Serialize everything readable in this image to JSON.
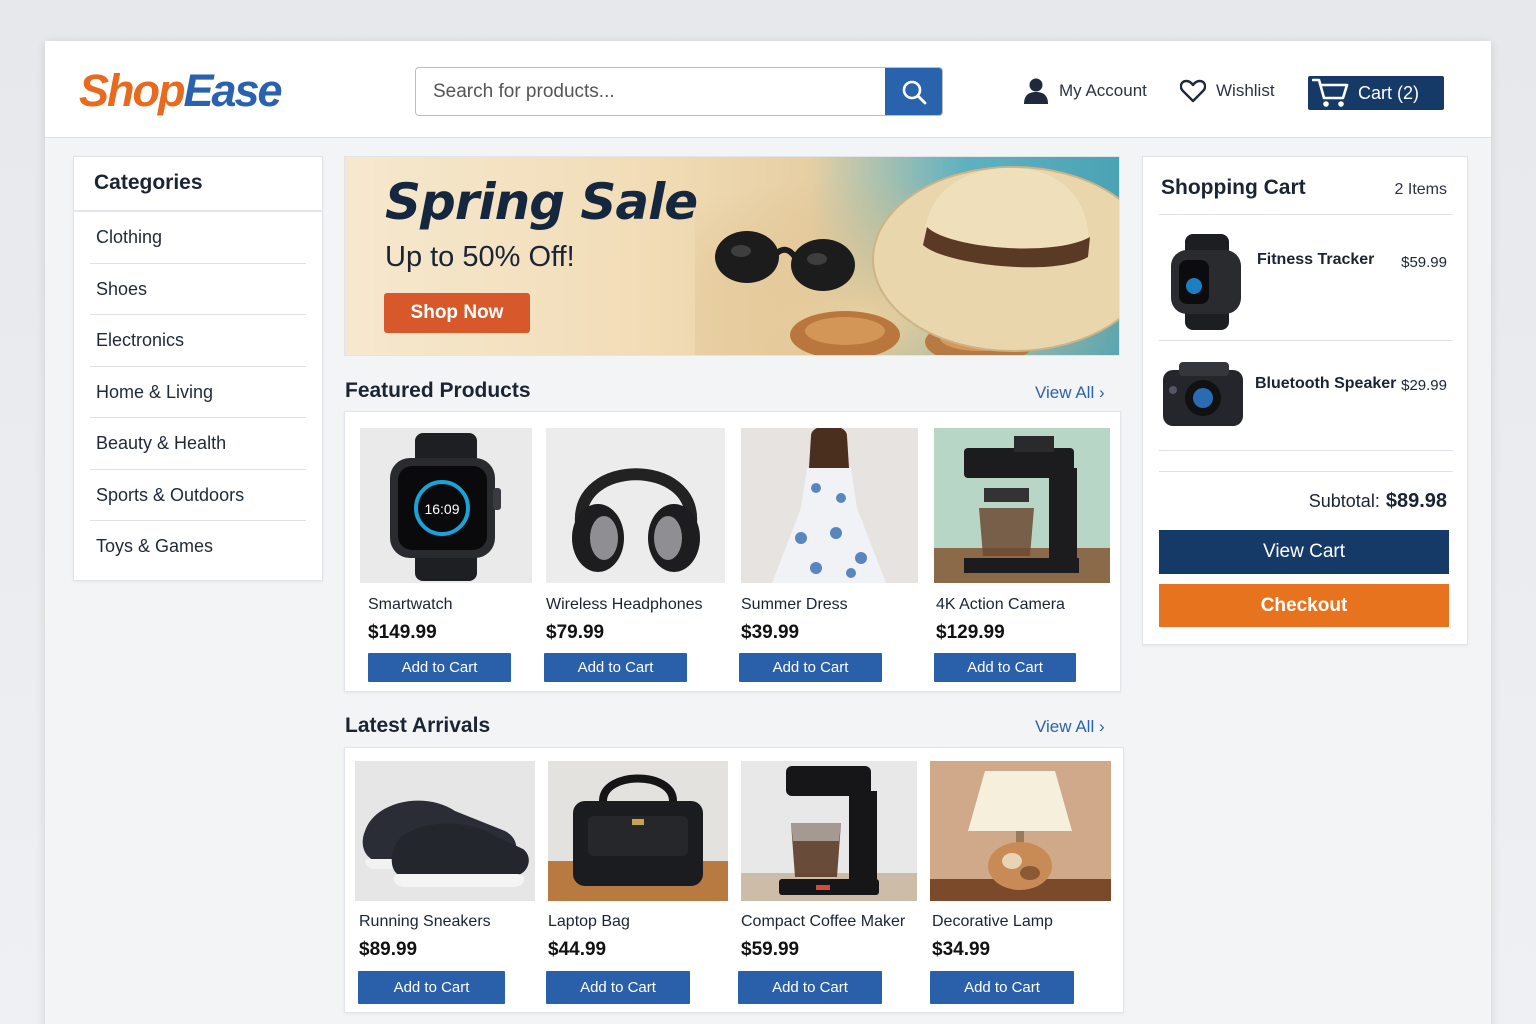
{
  "brand": {
    "logo_part1": "Shop",
    "logo_part2": "Ease",
    "color_orange": "#e86a1e",
    "color_blue": "#2a62ad"
  },
  "header": {
    "search_placeholder": "Search for products...",
    "account_label": "My Account",
    "wishlist_label": "Wishlist",
    "cart_label": "Cart (2)"
  },
  "sidebar": {
    "title": "Categories",
    "items": [
      "Clothing",
      "Shoes",
      "Electronics",
      "Home & Living",
      "Beauty & Health",
      "Sports & Outdoors",
      "Toys & Games"
    ]
  },
  "banner": {
    "title": "Spring Sale",
    "subtitle": "Up to 50% Off!",
    "cta": "Shop Now"
  },
  "featured": {
    "title": "Featured Products",
    "view_all": "View All ›",
    "products": [
      {
        "name": "Smartwatch",
        "price": "$149.99",
        "button": "Add to Cart",
        "watch_time": "16:09",
        "icon": "smartwatch-image"
      },
      {
        "name": "Wireless Headphones",
        "price": "$79.99",
        "button": "Add to Cart",
        "icon": "headphones-image"
      },
      {
        "name": "Summer Dress",
        "price": "$39.99",
        "button": "Add to Cart",
        "icon": "dress-image"
      },
      {
        "name": "4K Action Camera",
        "price": "$129.99",
        "button": "Add to Cart",
        "icon": "coffee-maker-image"
      }
    ]
  },
  "latest": {
    "title": "Latest Arrivals",
    "view_all": "View All ›",
    "products": [
      {
        "name": "Running Sneakers",
        "price": "$89.99",
        "button": "Add to Cart",
        "icon": "sneakers-image"
      },
      {
        "name": "Laptop Bag",
        "price": "$44.99",
        "button": "Add to Cart",
        "icon": "bag-image"
      },
      {
        "name": "Compact Coffee Maker",
        "price": "$59.99",
        "button": "Add to Cart",
        "icon": "coffee-maker-image"
      },
      {
        "name": "Decorative Lamp",
        "price": "$34.99",
        "button": "Add to Cart",
        "icon": "lamp-image"
      }
    ]
  },
  "cart": {
    "title": "Shopping Cart",
    "count": "2 Items",
    "items": [
      {
        "name": "Fitness Tracker",
        "price": "$59.99"
      },
      {
        "name": "Bluetooth Speaker",
        "price": "$29.99"
      }
    ],
    "subtotal_label": "Subtotal:",
    "subtotal_value": "$89.98",
    "view_cart": "View Cart",
    "checkout": "Checkout"
  },
  "colors": {
    "navy": "#163a68",
    "button_blue": "#2a5fa9",
    "checkout_orange": "#e8731e",
    "shop_now": "#d7582a"
  }
}
